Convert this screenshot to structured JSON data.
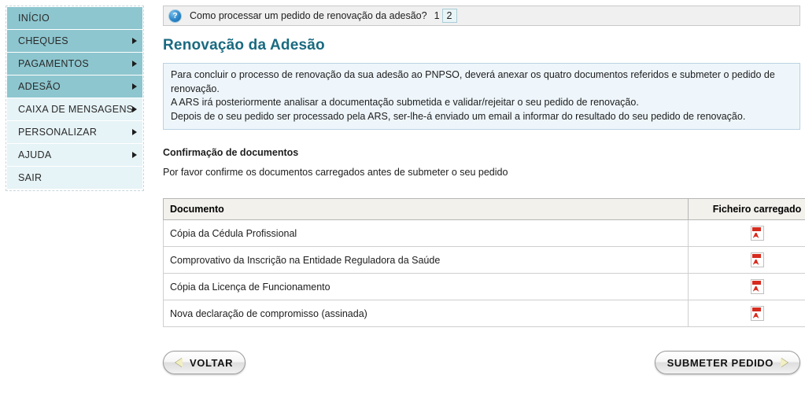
{
  "sidebar": {
    "items": [
      {
        "label": "INÍCIO",
        "style": "dark",
        "arrow": false
      },
      {
        "label": "CHEQUES",
        "style": "dark",
        "arrow": true
      },
      {
        "label": "PAGAMENTOS",
        "style": "dark",
        "arrow": true
      },
      {
        "label": "ADESÃO",
        "style": "dark",
        "arrow": true
      },
      {
        "label": "CAIXA DE MENSAGENS",
        "style": "light",
        "arrow": true
      },
      {
        "label": "PERSONALIZAR",
        "style": "light",
        "arrow": true
      },
      {
        "label": "AJUDA",
        "style": "light",
        "arrow": true
      },
      {
        "label": "SAIR",
        "style": "light",
        "arrow": false
      }
    ]
  },
  "help_bar": {
    "icon": "question-mark-icon",
    "text": "Como processar um pedido de renovação da adesão?",
    "pages": [
      "1",
      "2"
    ],
    "current_page": "2"
  },
  "page_title": "Renovação da Adesão",
  "info_box": {
    "lines": [
      "Para concluir o processo de renovação da sua adesão ao PNPSO, deverá anexar os quatro documentos referidos e submeter o pedido de renovação.",
      "A ARS irá posteriormente analisar a documentação submetida e validar/rejeitar o seu pedido de renovação.",
      "Depois de o seu pedido ser processado pela ARS, ser-lhe-á enviado um email a informar do resultado do seu pedido de renovação."
    ]
  },
  "section": {
    "title": "Confirmação de documentos",
    "subtitle": "Por favor confirme os documentos carregados antes de submeter o seu pedido"
  },
  "table": {
    "headers": [
      "Documento",
      "Ficheiro carregado"
    ],
    "rows": [
      {
        "document": "Cópia da Cédula Profissional",
        "file": "pdf-icon"
      },
      {
        "document": "Comprovativo da Inscrição na Entidade Reguladora da Saúde",
        "file": "pdf-icon"
      },
      {
        "document": "Cópia da Licença de Funcionamento",
        "file": "pdf-icon"
      },
      {
        "document": "Nova declaração de compromisso (assinada)",
        "file": "pdf-icon"
      }
    ]
  },
  "buttons": {
    "back": "VOLTAR",
    "submit": "SUBMETER PEDIDO"
  },
  "colors": {
    "sidebar_dark": "#8dc6cf",
    "sidebar_light": "#e6f3f7",
    "title": "#196a80",
    "info_bg": "#eef6fb",
    "info_border": "#b9d2e2",
    "pdf_red": "#d72b1f"
  }
}
